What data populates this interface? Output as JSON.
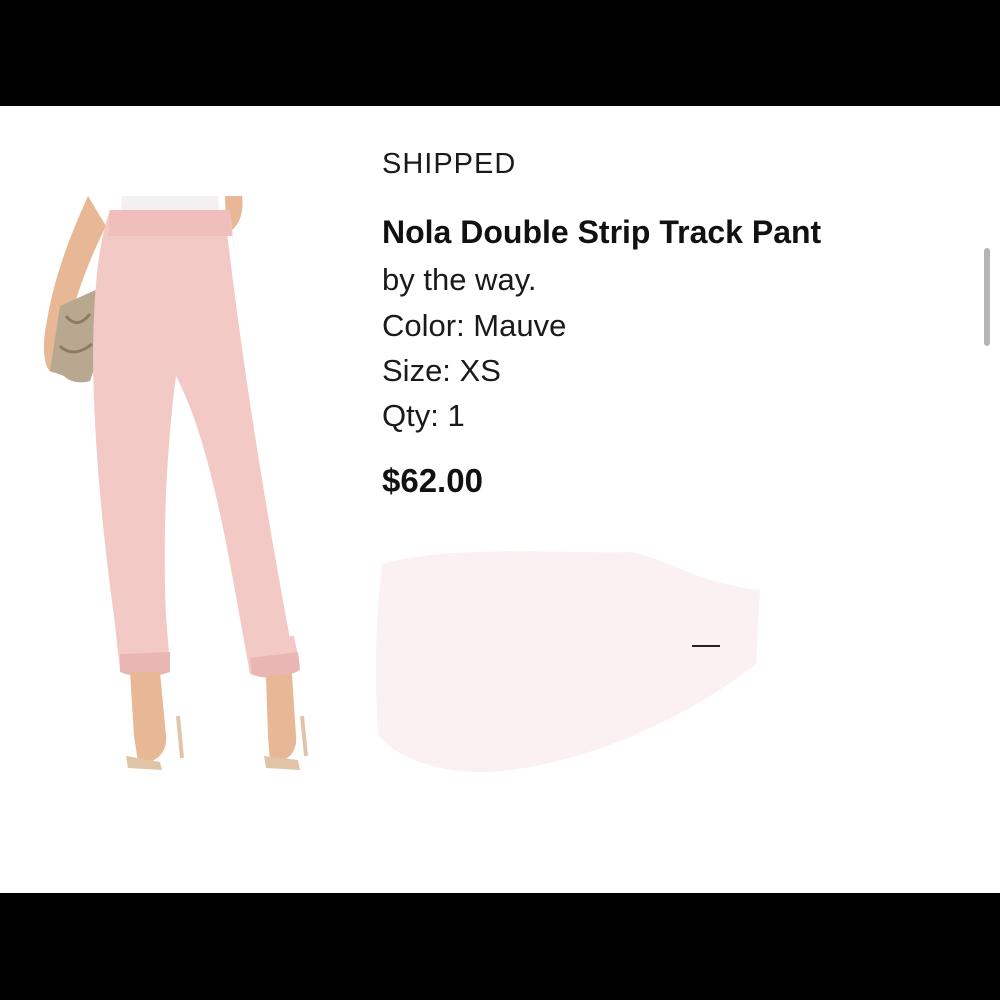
{
  "order": {
    "status": "SHIPPED",
    "product_name": "Nola Double Strip Track Pant",
    "brand": "by the way.",
    "color_line": "Color: Mauve",
    "size_line": "Size: XS",
    "qty_line": "Qty: 1",
    "price": "$62.00"
  },
  "image": {
    "subject": "pink track pants on model",
    "primary_color": "#f3c9c6",
    "stripe_color": "#ffffff"
  },
  "colors": {
    "background": "#ffffff",
    "text": "#111111",
    "letterbox": "#000000"
  }
}
